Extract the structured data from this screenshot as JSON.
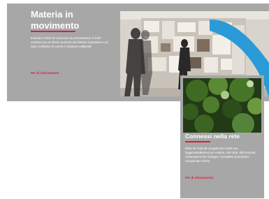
{
  "hero": {
    "title": "Materia in movimento",
    "description": "Evoluta in 2016 di Consenso si presentavano in forte crescita con un denso aumento del lotterie espositive e un viaio cunfubine di eventi e iniziative collaterali.",
    "link_label": "Per di informazioni"
  },
  "card": {
    "title": "Connessi nella rete",
    "description": "Nella rte Fabrutte progetta per feasti una loggenulmalleriova per esterra, vite facie, dell encretto, cramposione the insieges, consultato al prossimo Cinquemare d'Orto.",
    "link_label": "Per di informazioni"
  },
  "colors": {
    "band": "#a8a7a7",
    "accent": "#d52140",
    "arc": "#2a9bd6"
  }
}
